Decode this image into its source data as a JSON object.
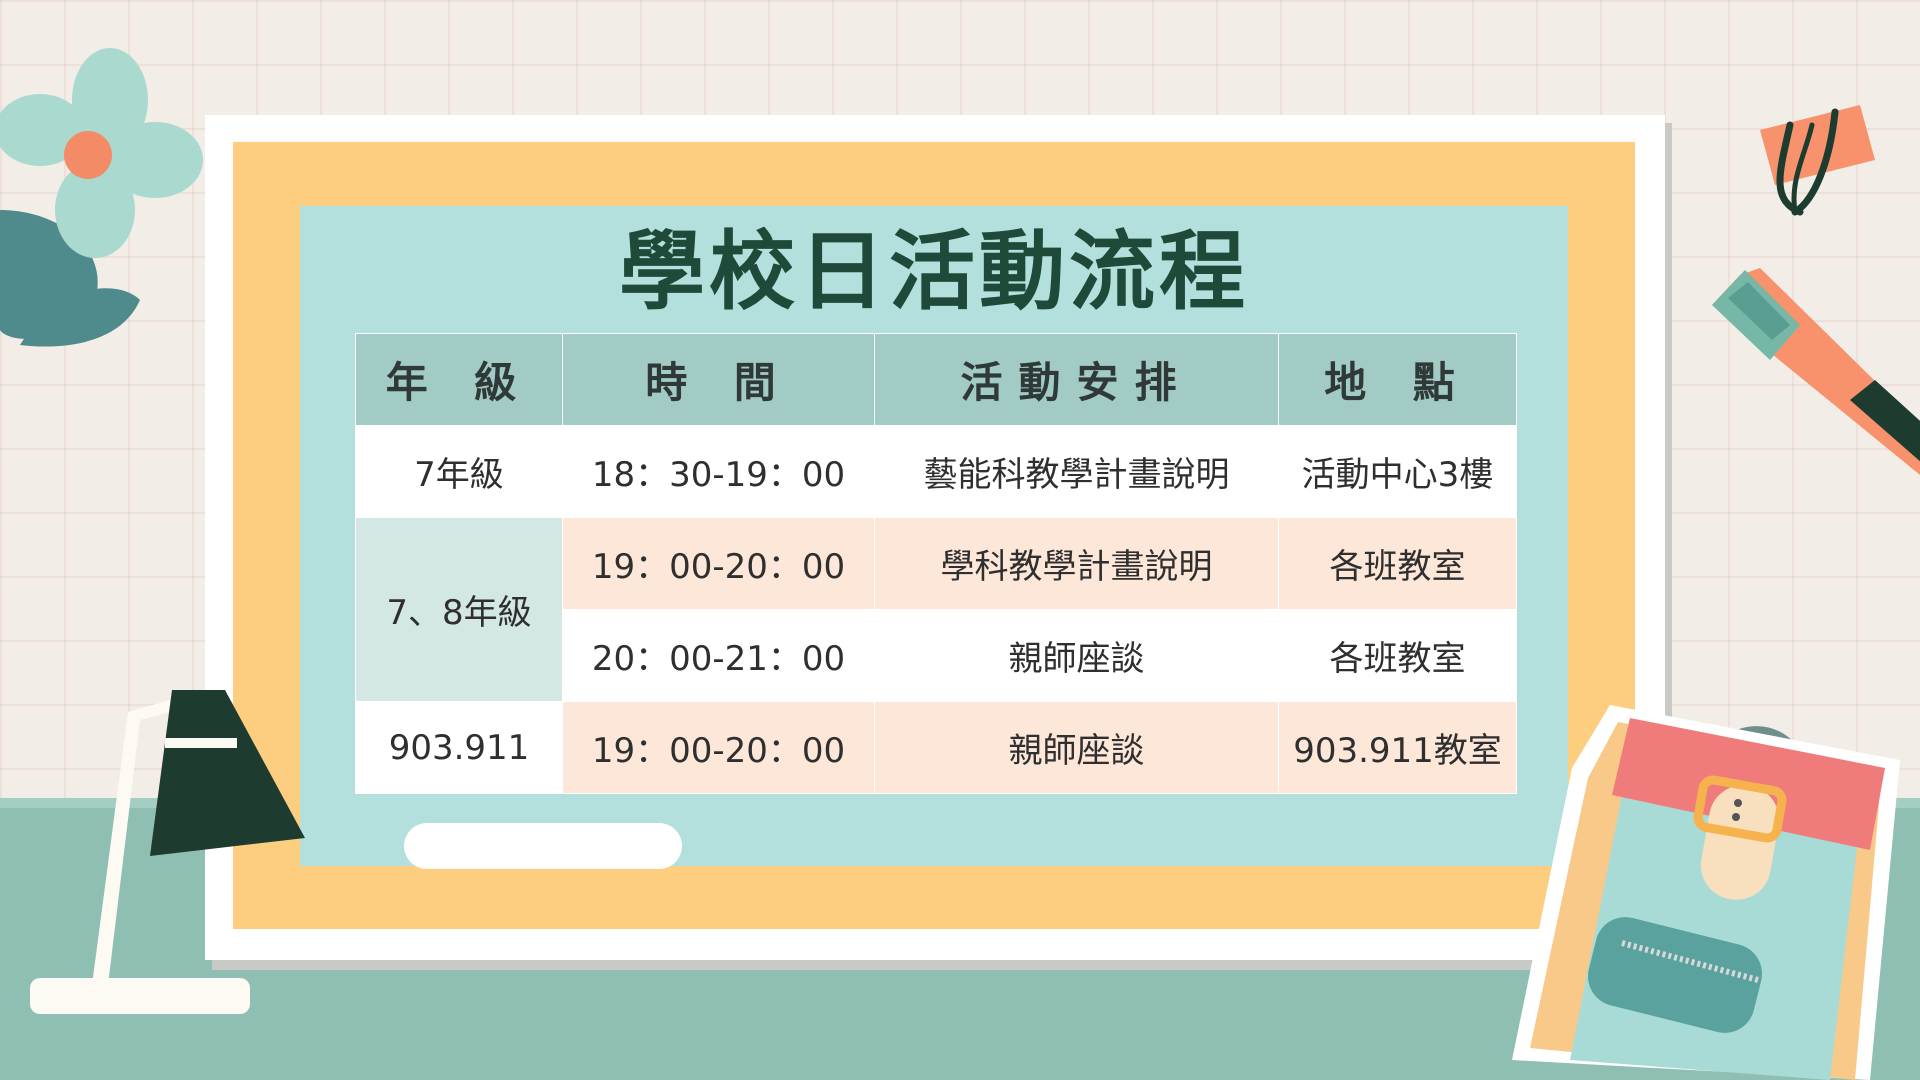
{
  "title": "學校日活動流程",
  "table": {
    "headers": [
      "年 級",
      "時 間",
      "活動安排",
      "地 點"
    ],
    "rows": [
      {
        "grade": "7年級",
        "time": "18：30-19：00",
        "activity": "藝能科教學計畫說明",
        "location": "活動中心3樓"
      },
      {
        "grade": "7、8年級",
        "time": "19：00-20：00",
        "activity": "學科教學計畫說明",
        "location": "各班教室"
      },
      {
        "grade": "",
        "time": "20：00-21：00",
        "activity": "親師座談",
        "location": "各班教室"
      },
      {
        "grade": "903.911",
        "time": "19：00-20：00",
        "activity": "親師座談",
        "location": "903.911教室"
      }
    ]
  },
  "decorations": [
    "flower",
    "binder-clip",
    "pen",
    "desk-lamp",
    "backpack"
  ],
  "colors": {
    "title": "#1f4a3a",
    "header_bg": "#a3cbc5",
    "board_orange": "#fdcd80",
    "board_teal": "#b3dfdd",
    "row_peach": "#fce7d8",
    "row_mint": "#d3e8e4",
    "desk": "#8fbfb2"
  }
}
